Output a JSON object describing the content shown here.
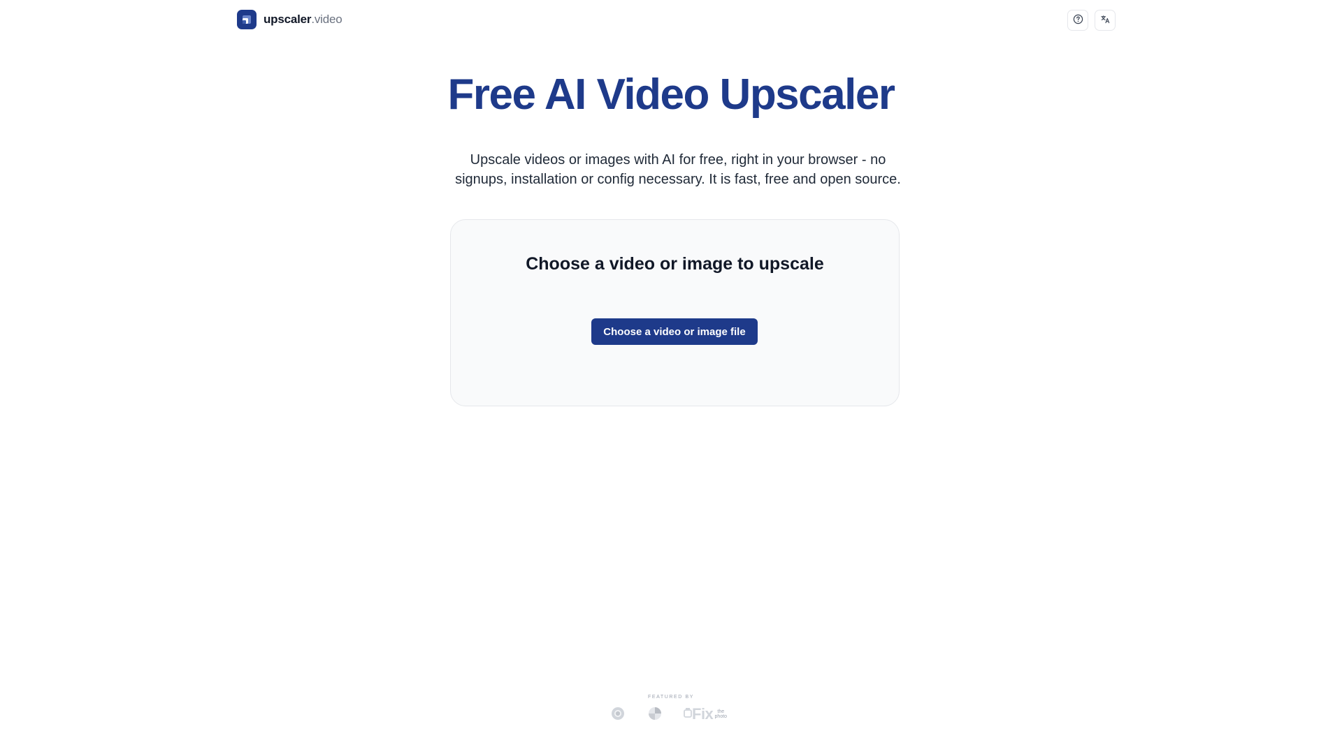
{
  "header": {
    "brand_name": "upscaler",
    "brand_tld": ".video",
    "help_icon": "question-circle-icon",
    "language_icon": "translate-icon"
  },
  "hero": {
    "title": "Free AI Video Upscaler",
    "subtitle": "Upscale videos or images with AI for free, right in your browser - no signups, installation or config necessary. It is fast, free and open source."
  },
  "upload": {
    "heading": "Choose a video or image to upscale",
    "button_label": "Choose a video or image file"
  },
  "featured": {
    "label": "FEATURED BY",
    "logo_c_text": "Fix",
    "logo_c_small": "the photo"
  },
  "colors": {
    "brand_blue": "#1e3a8a",
    "card_bg": "#f9fafb",
    "border": "#e5e7eb"
  }
}
